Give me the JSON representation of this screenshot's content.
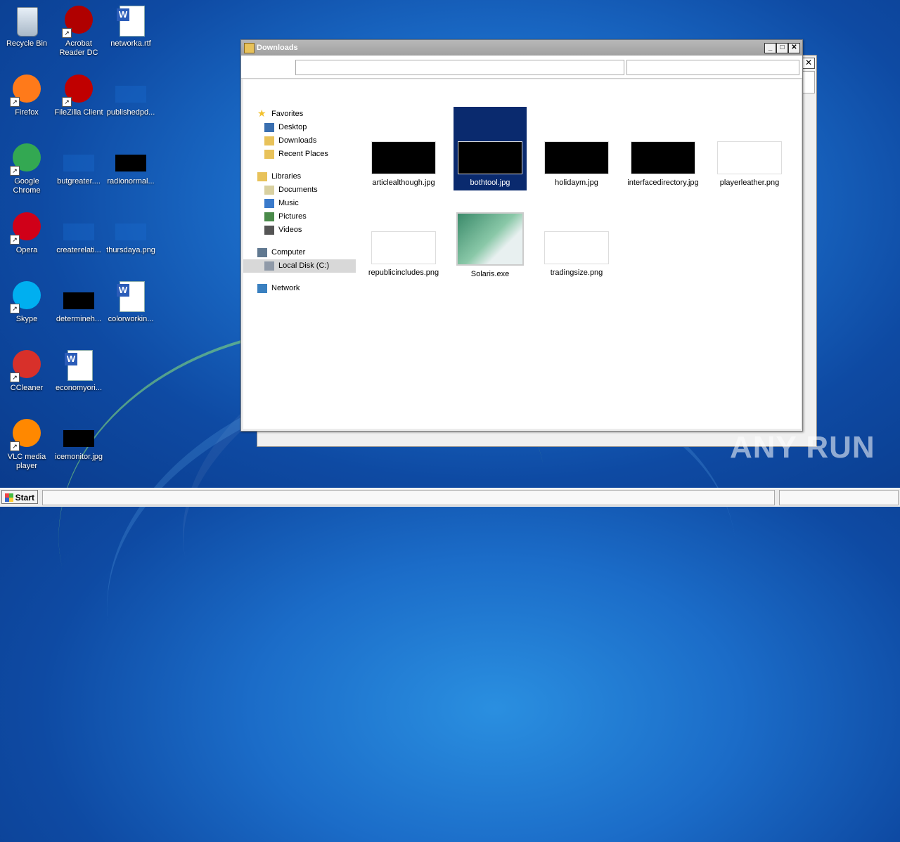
{
  "desktop": {
    "icons": [
      {
        "label": "Recycle Bin",
        "icon": "recycle-bin-icon",
        "color": "#c8d8e8"
      },
      {
        "label": "Acrobat\nReader DC",
        "icon": "acrobat-icon",
        "color": "#b00000"
      },
      {
        "label": "networka.rtf",
        "icon": "word-doc-icon",
        "color": "#ffffff"
      },
      {
        "label": "Firefox",
        "icon": "firefox-icon",
        "color": "#ff7a1a"
      },
      {
        "label": "FileZilla Client",
        "icon": "filezilla-icon",
        "color": "#c00000"
      },
      {
        "label": "publishedpd...",
        "icon": "blank-file-icon",
        "color": "#1a6cd0"
      },
      {
        "label": "Google\nChrome",
        "icon": "chrome-icon",
        "color": "#33a852"
      },
      {
        "label": "butgreater....",
        "icon": "blank-file-icon",
        "color": "#1a6cd0"
      },
      {
        "label": "radionormal...",
        "icon": "image-file-icon",
        "color": "#000000"
      },
      {
        "label": "Opera",
        "icon": "opera-icon",
        "color": "#d00018"
      },
      {
        "label": "createrelati...",
        "icon": "blank-file-icon",
        "color": "#1a6cd0"
      },
      {
        "label": "thursdaya.png",
        "icon": "blank-file-icon",
        "color": "#1a6cd0"
      },
      {
        "label": "Skype",
        "icon": "skype-icon",
        "color": "#00aff0"
      },
      {
        "label": "determineh...",
        "icon": "image-file-icon",
        "color": "#000000"
      },
      {
        "label": "colorworkin...",
        "icon": "word-doc-icon",
        "color": "#ffffff"
      },
      {
        "label": "CCleaner",
        "icon": "ccleaner-icon",
        "color": "#d8302a"
      },
      {
        "label": "economyori...",
        "icon": "word-doc-icon",
        "color": "#ffffff"
      },
      {
        "label": "VLC media\nplayer",
        "icon": "vlc-icon",
        "color": "#ff8800"
      },
      {
        "label": "icemonitor.jpg",
        "icon": "image-file-icon",
        "color": "#000000"
      }
    ]
  },
  "explorer": {
    "title": "Downloads",
    "title_icon": "folder-icon",
    "buttons": {
      "minimize": "_",
      "maximize": "□",
      "close": "✕"
    },
    "nav": [
      {
        "label": "Favorites",
        "icon": "star-icon",
        "level": 0
      },
      {
        "label": "Desktop",
        "icon": "desktop-icon",
        "level": 1
      },
      {
        "label": "Downloads",
        "icon": "downloads-folder-icon",
        "level": 1
      },
      {
        "label": "Recent Places",
        "icon": "recent-places-icon",
        "level": 1
      },
      {
        "label": "Libraries",
        "icon": "libraries-icon",
        "level": 0
      },
      {
        "label": "Documents",
        "icon": "documents-icon",
        "level": 1
      },
      {
        "label": "Music",
        "icon": "music-icon",
        "level": 1
      },
      {
        "label": "Pictures",
        "icon": "pictures-icon",
        "level": 1
      },
      {
        "label": "Videos",
        "icon": "videos-icon",
        "level": 1
      },
      {
        "label": "Computer",
        "icon": "computer-icon",
        "level": 0
      },
      {
        "label": "Local Disk (C:)",
        "icon": "local-disk-icon",
        "level": 1,
        "selected": true
      },
      {
        "label": "Network",
        "icon": "network-icon",
        "level": 0
      }
    ],
    "files": [
      {
        "name": "articlealthough.jpg",
        "thumb": "#000000"
      },
      {
        "name": "bothtool.jpg",
        "thumb": "#000000",
        "selected": true
      },
      {
        "name": "holidaym.jpg",
        "thumb": "#000000"
      },
      {
        "name": "interfacedirectory.jpg",
        "thumb": "#000000"
      },
      {
        "name": "playerleather.png",
        "thumb": "#ffffff"
      },
      {
        "name": "republicincludes.png",
        "thumb": "#ffffff"
      },
      {
        "name": "Solaris.exe",
        "thumb": "#dfe8e0"
      },
      {
        "name": "tradingsize.png",
        "thumb": "#ffffff"
      }
    ]
  },
  "taskbar": {
    "start_label": "Start"
  },
  "watermark": "ANY RUN"
}
